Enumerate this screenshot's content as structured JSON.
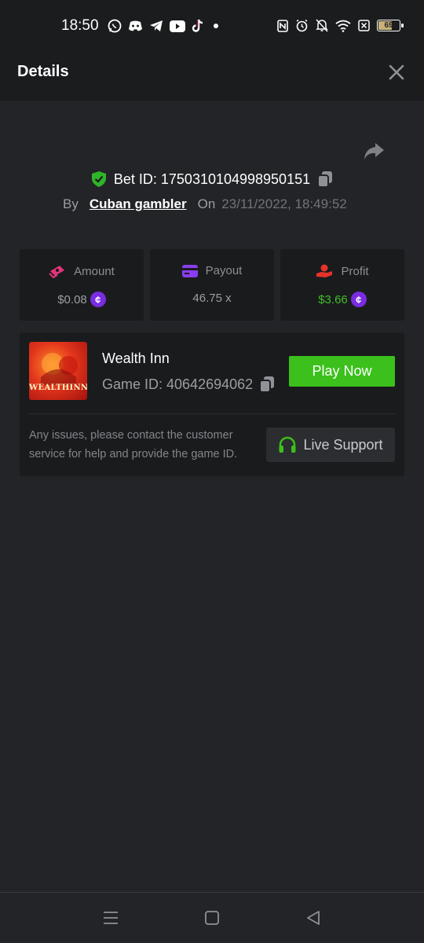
{
  "status_bar": {
    "time": "18:50",
    "battery_level": "69",
    "battery_fraction": 0.69,
    "app_icons": [
      "whatsapp-icon",
      "discord-icon",
      "telegram-icon",
      "youtube-icon",
      "tiktok-icon",
      "dot-icon"
    ],
    "system_icons": [
      "nfc-icon",
      "alarm-icon",
      "mute-icon",
      "wifi-icon",
      "sim-off-icon",
      "battery-icon"
    ]
  },
  "header": {
    "title": "Details",
    "close_icon": "close-icon"
  },
  "bet": {
    "id_text": "Bet ID: 1750310104998950151",
    "by_label": "By",
    "user": "Cuban gambler",
    "on_label": "On",
    "date": "23/11/2022, 18:49:52"
  },
  "stats": {
    "amount": {
      "label": "Amount",
      "value": "$0.08"
    },
    "payout": {
      "label": "Payout",
      "value": "46.75 x"
    },
    "profit": {
      "label": "Profit",
      "value": "$3.66"
    }
  },
  "game": {
    "name": "Wealth Inn",
    "thumb_text": "WEALTHINN",
    "id_text": "Game ID: 40642694062",
    "play_label": "Play Now",
    "issues_text": "Any issues, please contact the customer service for help and provide the game ID.",
    "support_label": "Live Support"
  },
  "colors": {
    "accent_green": "#3bc01c",
    "profit_green": "#3fbf27",
    "coin_purple": "#7a2ce0",
    "amount_pink": "#e0337a",
    "payout_purple": "#8a3cf0",
    "profit_red": "#e5332a"
  }
}
